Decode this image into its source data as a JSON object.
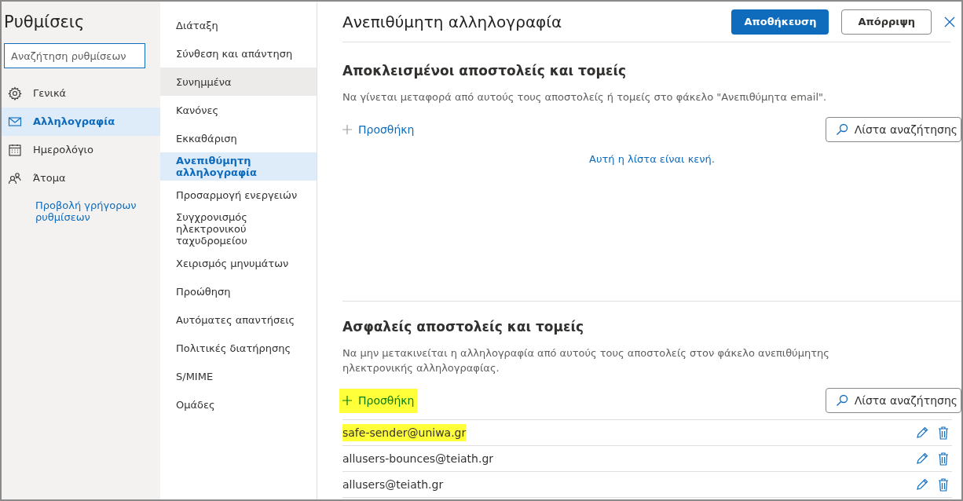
{
  "sidebar": {
    "title": "Ρυθμίσεις",
    "search": {
      "placeholder": "Αναζήτηση ρυθμίσεων"
    },
    "items": [
      {
        "kind": "gear",
        "label": "Γενικά",
        "selected": false
      },
      {
        "kind": "mail",
        "label": "Αλληλογραφία",
        "selected": true
      },
      {
        "kind": "calendar",
        "label": "Ημερολόγιο",
        "selected": false
      },
      {
        "kind": "people",
        "label": "Άτομα",
        "selected": false
      }
    ],
    "quick_settings_link": "Προβολή γρήγορων ρυθμίσεων"
  },
  "submenu": {
    "items": [
      {
        "label": "Διάταξη",
        "selected": false,
        "hovered": false
      },
      {
        "label": "Σύνθεση και απάντηση",
        "selected": false,
        "hovered": false
      },
      {
        "label": "Συνημμένα",
        "selected": false,
        "hovered": true
      },
      {
        "label": "Κανόνες",
        "selected": false,
        "hovered": false
      },
      {
        "label": "Εκκαθάριση",
        "selected": false,
        "hovered": false
      },
      {
        "label": "Ανεπιθύμητη αλληλογραφία",
        "selected": true,
        "hovered": false
      },
      {
        "label": "Προσαρμογή ενεργειών",
        "selected": false,
        "hovered": false
      },
      {
        "label": "Συγχρονισμός ηλεκτρονικού ταχυδρομείου",
        "selected": false,
        "hovered": false
      },
      {
        "label": "Χειρισμός μηνυμάτων",
        "selected": false,
        "hovered": false
      },
      {
        "label": "Προώθηση",
        "selected": false,
        "hovered": false
      },
      {
        "label": "Αυτόματες απαντήσεις",
        "selected": false,
        "hovered": false
      },
      {
        "label": "Πολιτικές διατήρησης",
        "selected": false,
        "hovered": false
      },
      {
        "label": "S/MIME",
        "selected": false,
        "hovered": false
      },
      {
        "label": "Ομάδες",
        "selected": false,
        "hovered": false
      }
    ]
  },
  "panel": {
    "title": "Ανεπιθύμητη αλληλογραφία",
    "save_button": "Αποθήκευση",
    "discard_button": "Απόρριψη",
    "sections": [
      {
        "heading": "Αποκλεισμένοι αποστολείς και τομείς",
        "description": "Να γίνεται μεταφορά από αυτούς τους αποστολείς ή τομείς στο φάκελο \"Ανεπιθύμητα email\".",
        "add_button": {
          "label": "Προσθήκη",
          "highlighted": false
        },
        "search_button": "Λίστα αναζήτησης",
        "empty_message": "Αυτή η λίστα είναι κενή."
      },
      {
        "heading": "Ασφαλείς αποστολείς και τομείς",
        "description": "Να μην μετακινείται η αλληλογραφία από αυτούς τους αποστολείς στον φάκελο ανεπιθύμητης ηλεκτρονικής αλληλογραφίας.",
        "add_button": {
          "label": "Προσθήκη",
          "highlighted": true
        },
        "search_button": "Λίστα αναζήτησης",
        "entries": [
          {
            "address": "safe-sender@uniwa.gr",
            "highlighted": true
          },
          {
            "address": "allusers-bounces@teiath.gr",
            "highlighted": false
          },
          {
            "address": "allusers@teiath.gr",
            "highlighted": false
          }
        ]
      }
    ]
  }
}
